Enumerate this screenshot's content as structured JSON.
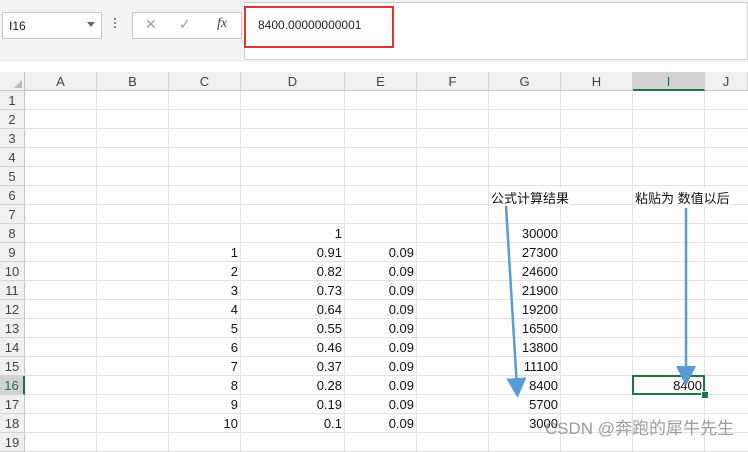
{
  "name_box": "I16",
  "formula_bar": {
    "cancel_glyph": "✕",
    "enter_glyph": "✓",
    "fx_label": "fx",
    "value": "8400.00000000001"
  },
  "columns": [
    "A",
    "B",
    "C",
    "D",
    "E",
    "F",
    "G",
    "H",
    "I",
    "J"
  ],
  "rows": [
    "1",
    "2",
    "3",
    "4",
    "5",
    "6",
    "7",
    "8",
    "9",
    "10",
    "11",
    "12",
    "13",
    "14",
    "15",
    "16",
    "17",
    "18",
    "19"
  ],
  "selected": {
    "col": "I",
    "row": "16"
  },
  "cells": {
    "D8": "1",
    "C9": "1",
    "D9": "0.91",
    "E9": "0.09",
    "G9": "27300",
    "C10": "2",
    "D10": "0.82",
    "E10": "0.09",
    "G10": "24600",
    "C11": "3",
    "D11": "0.73",
    "E11": "0.09",
    "G11": "21900",
    "C12": "4",
    "D12": "0.64",
    "E12": "0.09",
    "G12": "19200",
    "C13": "5",
    "D13": "0.55",
    "E13": "0.09",
    "G13": "16500",
    "C14": "6",
    "D14": "0.46",
    "E14": "0.09",
    "G14": "13800",
    "C15": "7",
    "D15": "0.37",
    "E15": "0.09",
    "G15": "11100",
    "C16": "8",
    "D16": "0.28",
    "E16": "0.09",
    "G16": "8400",
    "C17": "9",
    "D17": "0.19",
    "E17": "0.09",
    "G17": "5700",
    "C18": "10",
    "D18": "0.1",
    "E18": "0.09",
    "G18": "3000",
    "G8": "30000",
    "I16": "8400"
  },
  "annotations": {
    "formula_result_label": "公式计算结果",
    "paste_value_label": "粘贴为 数值以后"
  },
  "watermark": "CSDN @奔跑的犀牛先生",
  "colors": {
    "accent": "#217346",
    "highlight": "#e0343a",
    "arrow": "#5b9bd5"
  }
}
